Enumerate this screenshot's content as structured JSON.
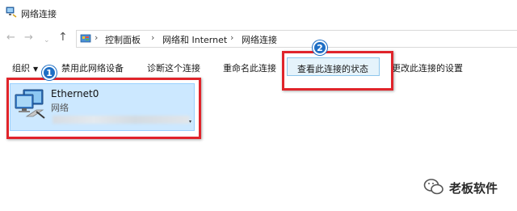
{
  "window": {
    "title": "网络连接",
    "icon": "network-connections-icon"
  },
  "navigation": {
    "back_icon": "←",
    "forward_icon": "→",
    "recent_icon": "⌄",
    "up_icon": "↑",
    "breadcrumb": [
      "控制面板",
      "网络和 Internet",
      "网络连接"
    ],
    "separator": "›"
  },
  "toolbar": {
    "organize_label": "组织",
    "organize_caret": "▼",
    "disable_label": "禁用此网络设备",
    "diagnose_label": "诊断这个连接",
    "rename_label": "重命名此连接",
    "status_label": "查看此连接的状态",
    "settings_label": "更改此连接的设置"
  },
  "connections": [
    {
      "name": "Ethernet0",
      "type": "网络",
      "selected": true
    }
  ],
  "annotations": {
    "badge_1": "1",
    "badge_2": "2",
    "highlight_color": "#e0242b",
    "badge_color": "#1f6fc5"
  },
  "watermark": {
    "text": "老板软件",
    "icon": "wechat-icon"
  },
  "colors": {
    "selection_fill": "#cce8ff",
    "selection_border": "#99d1ff",
    "hover_fill": "#e5f3fb"
  }
}
